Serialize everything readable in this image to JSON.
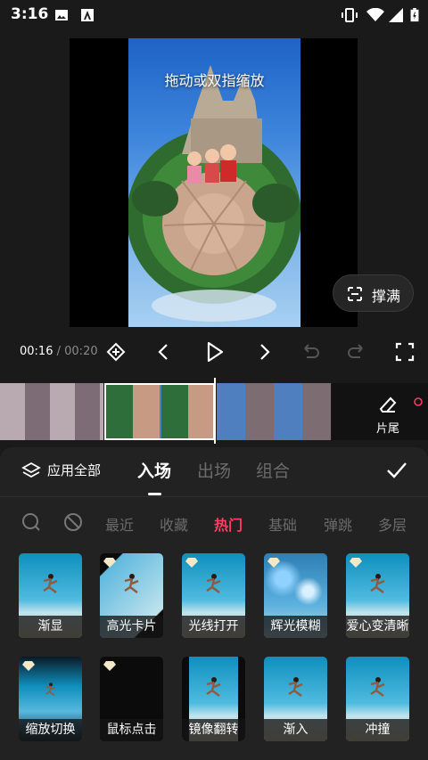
{
  "status_bar": {
    "time": "3:16"
  },
  "preview": {
    "hint": "拖动或双指缩放",
    "fill_button": "撑满"
  },
  "playback": {
    "current_time": "00:16",
    "separator": "/",
    "total_time": "00:20"
  },
  "timeline": {
    "end_label": "片尾"
  },
  "panel": {
    "apply_all": "应用全部",
    "tabs": [
      "入场",
      "出场",
      "组合"
    ],
    "categories": [
      "最近",
      "收藏",
      "热门",
      "基础",
      "弹跳",
      "多层"
    ],
    "effects": [
      "渐显",
      "高光卡片",
      "光线打开",
      "辉光模糊",
      "爱心变清晰",
      "缩放切换",
      "鼠标点击",
      "镜像翻转",
      "渐入",
      "冲撞"
    ]
  },
  "colors": {
    "accent": "#ff3d63",
    "background": "#1a1a1a",
    "panel": "#222222"
  }
}
